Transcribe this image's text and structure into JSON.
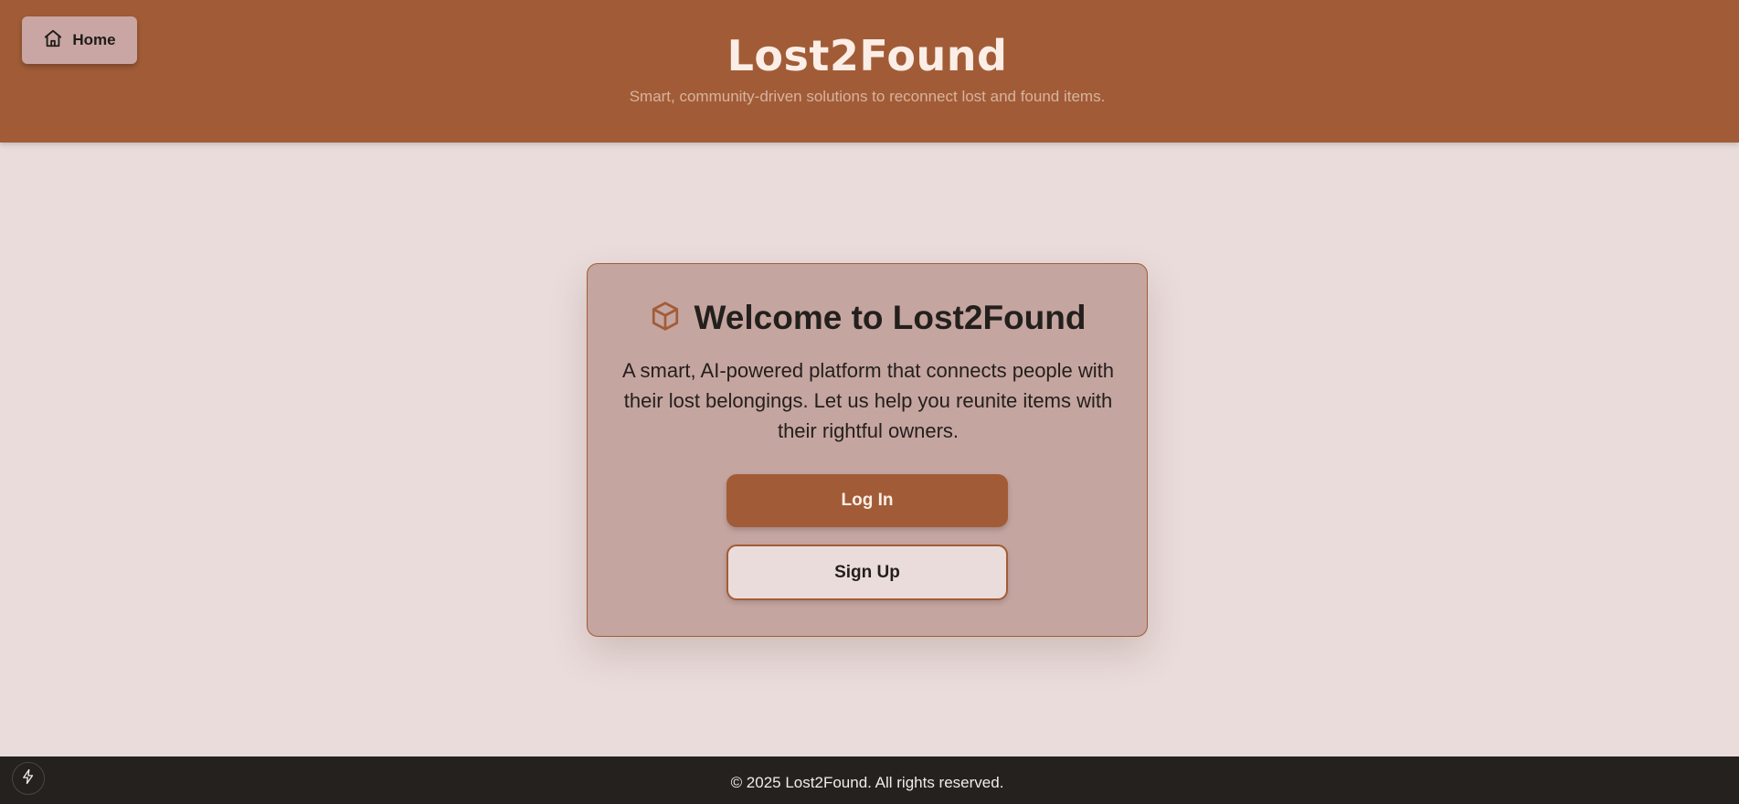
{
  "header": {
    "home_button_label": "Home",
    "home_icon": "home-icon",
    "title": "Lost2Found",
    "subtitle": "Smart, community-driven solutions to reconnect lost and found items."
  },
  "card": {
    "icon": "package-icon",
    "title": "Welcome to Lost2Found",
    "description": "A smart, AI-powered platform that connects people with their lost belongings. Let us help you reunite items with their rightful owners.",
    "login_label": "Log In",
    "signup_label": "Sign Up"
  },
  "footer": {
    "copyright": "© 2025 Lost2Found. All rights reserved."
  },
  "dev_badge": {
    "icon": "lightning-icon"
  },
  "colors": {
    "brand": "#a15c37",
    "background": "#e9dcdb",
    "card_background": "#c5a5a0",
    "footer_background": "#24211e",
    "title_text": "#fbeee6"
  }
}
